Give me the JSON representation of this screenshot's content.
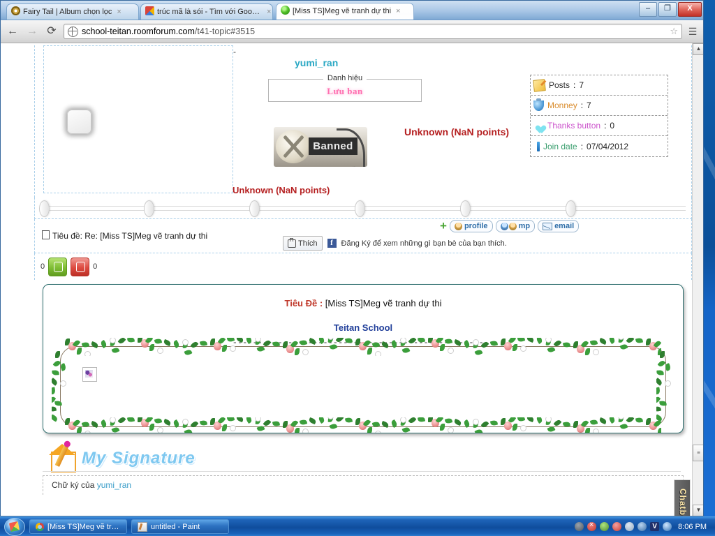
{
  "browser": {
    "tabs": [
      {
        "title": "Fairy Tail | Album chọn lọc",
        "favicon": "spiral-icon",
        "close": "×",
        "active": false
      },
      {
        "title": "trúc mã là sói - Tìm với Google",
        "favicon": "google-icon",
        "close": "×",
        "active": false
      },
      {
        "title": "[Miss TS]Meg vẽ tranh dự thi",
        "favicon": "green-dot-icon",
        "close": "×",
        "active": true
      }
    ],
    "window_controls": {
      "minimize": "–",
      "maximize": "❐",
      "close": "X"
    },
    "toolbar": {
      "back": "←",
      "forward": "→",
      "reload": "⟳",
      "bookmark_star": "☆",
      "menu_wrench": "☰",
      "url_host": "school-teitan.roomforum.com",
      "url_path": "/t41-topic#3515",
      "url_full": "school-teitan.roomforum.com/t41-topic#3515"
    },
    "scrollbar": {
      "up": "▲",
      "down": "▼",
      "thumb": "≡"
    }
  },
  "post": {
    "dash_marker": "-",
    "username": "yumi_ran",
    "rank_legend": "Danh hiệu",
    "rank_value": "Lưu ban",
    "banned_badge": "Banned",
    "points_middle": "Unknown (NaN points)",
    "points_bottom": "Unknown (NaN points)",
    "stats": [
      {
        "icon": "note-icon",
        "label": "Posts",
        "value": "7"
      },
      {
        "icon": "moneybag-icon",
        "label": "Monney",
        "value": "7"
      },
      {
        "icon": "heart-icon",
        "label": "Thanks button",
        "value": "0"
      },
      {
        "icon": "calendar-icon",
        "label": "Join date",
        "value": "07/04/2012"
      }
    ],
    "subject_label": "Tiêu đề:",
    "subject_value": "Re: [Miss TS]Meg vẽ tranh dự thi",
    "facebook": {
      "like_label": "Thích",
      "fb_glyph": "f",
      "notice": "Đăng Ký để xem những gì bạn bè của bạn thích."
    },
    "actions": [
      {
        "name": "profile",
        "label": "profile"
      },
      {
        "name": "mp",
        "label": "mp"
      },
      {
        "name": "email",
        "label": "email"
      }
    ],
    "vote": {
      "up_count": "0",
      "down_count": "0"
    }
  },
  "message": {
    "title_label": "Tiêu Đề :",
    "title_value": "[Miss TS]Meg vẽ tranh dự thi",
    "school": "Teitan School",
    "divider": "----------------------------------------------------"
  },
  "signature": {
    "heading": "My Signature",
    "owner_prefix": "Chữ ký của",
    "owner": "yumi_ran"
  },
  "chatbox": {
    "label": "Chatbox"
  },
  "taskbar": {
    "start": "start-orb",
    "items": [
      {
        "icon": "chrome-icon",
        "label": "[Miss TS]Meg vẽ tranh..."
      },
      {
        "icon": "paint-icon",
        "label": "untitled - Paint"
      }
    ],
    "tray_icons": [
      "tray-shield-icon",
      "tray-error-icon",
      "tray-network-icon",
      "tray-shield2-icon",
      "tray-volume-icon",
      "tray-user-icon",
      "tray-v-icon",
      "tray-wifi-icon"
    ],
    "tray_v_glyph": "V",
    "clock": "8:06 PM"
  },
  "colors": {
    "accent_blue": "#2aa8c4",
    "danger_red": "#b52021",
    "title_red": "#c0392b",
    "school_blue": "#213f9a",
    "pink": "#ff6fb0"
  }
}
